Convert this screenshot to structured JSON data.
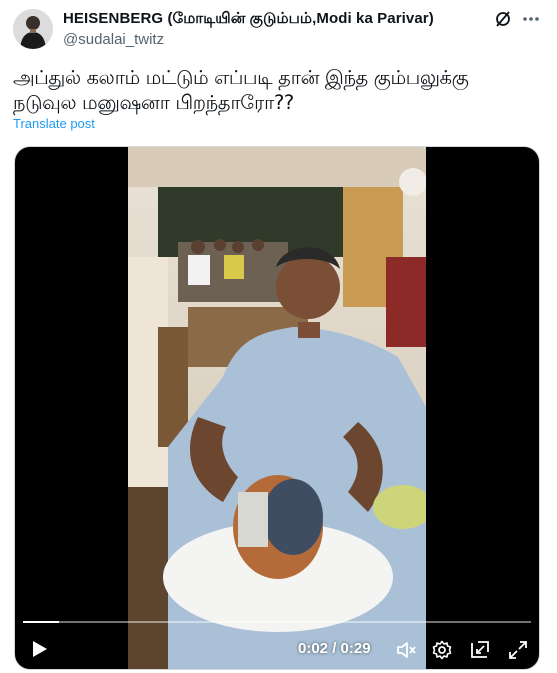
{
  "post": {
    "display_name": "HEISENBERG (மோடியின் குடும்பம்,Modi ka Parivar)",
    "handle": "@sudalai_twitz",
    "text": "அப்துல் கலாம் மட்டும் எப்படி தான் இந்த கும்பலுக்கு நடுவுல மனுஷனா பிறந்தாரோ??",
    "translate_label": "Translate post"
  },
  "video": {
    "time_label": "0:02 / 0:29",
    "progress_fraction": 0.07
  },
  "icons": {
    "header": [
      "grok-icon",
      "more-icon"
    ],
    "controls": [
      "play-icon",
      "volume-muted-icon",
      "settings-icon",
      "pip-icon",
      "fullscreen-icon"
    ]
  },
  "colors": {
    "link": "#1d9bf0",
    "secondary_text": "#536471",
    "video_background": "#000000"
  }
}
